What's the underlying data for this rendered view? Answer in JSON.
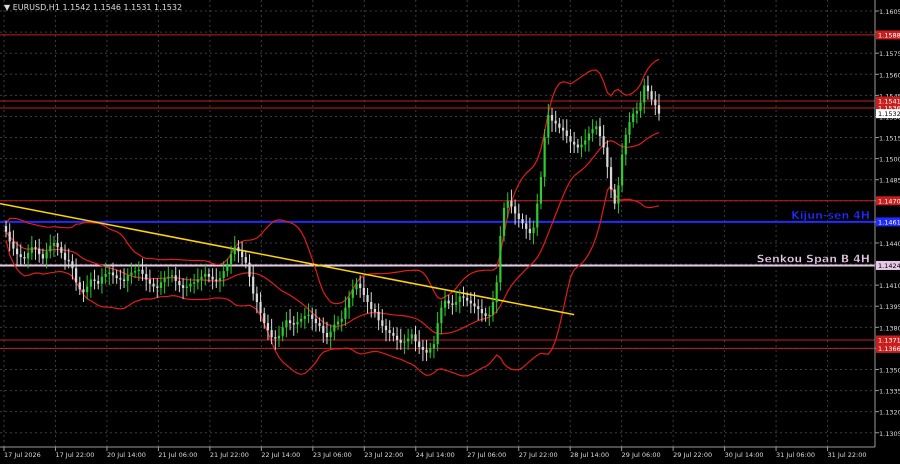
{
  "header": {
    "symbol_label": "▼ EURUSD,H1  1.1542 1.1546 1.1531 1.1532"
  },
  "colors": {
    "background": "#000000",
    "grid": "#3c3c3c",
    "bull_candle": "#2ecc2e",
    "bear_candle": "#d8d8d8",
    "price_axis_text": "#dcdcdc",
    "support_resistance": "#c81e1e",
    "kijun": "#1f2bff",
    "senkou": "#e6c8e6",
    "trendline": "#ffd400",
    "bollinger": "#e01c1c",
    "current_price_tag": "#ffffff"
  },
  "chart_data": {
    "type": "candlestick",
    "title": "EURUSD,H1",
    "ohlc_readout": {
      "open": 1.1542,
      "high": 1.1546,
      "low": 1.1531,
      "close": 1.1532
    },
    "ylim": [
      1.1297,
      1.161
    ],
    "y_ticks": [
      "1.1605",
      "1.1590",
      "1.1575",
      "1.1560",
      "1.1545",
      "1.1530",
      "1.1515",
      "1.1500",
      "1.1485",
      "1.1470",
      "1.1455",
      "1.1440",
      "1.1425",
      "1.1410",
      "1.1395",
      "1.1380",
      "1.1365",
      "1.1350",
      "1.1335",
      "1.1320",
      "1.1305"
    ],
    "x_ticks": [
      "17 Jul 2026",
      "17 Jul 22:00",
      "20 Jul 14:00",
      "21 Jul 06:00",
      "21 Jul 22:00",
      "22 Jul 14:00",
      "23 Jul 06:00",
      "23 Jul 22:00",
      "24 Jul 14:00",
      "27 Jul 06:00",
      "27 Jul 22:00",
      "28 Jul 14:00",
      "29 Jul 06:00",
      "29 Jul 22:00",
      "30 Jul 14:00",
      "31 Jul 06:00",
      "31 Jul 22:00"
    ],
    "horizontal_levels": [
      {
        "price": 1.1588,
        "tag": "1.1588",
        "kind": "resistance"
      },
      {
        "price": 1.1541,
        "tag": "1.1541",
        "kind": "resistance"
      },
      {
        "price": 1.1536,
        "tag": "1.1536",
        "kind": "resistance"
      },
      {
        "price": 1.147,
        "tag": "1.1470",
        "kind": "resistance"
      },
      {
        "price": 1.1455,
        "tag": "1.1461",
        "kind": "kijun",
        "label": "Kijun-sen 4H"
      },
      {
        "price": 1.1424,
        "tag": "1.1424",
        "kind": "senkou",
        "label": "Senkou Span B 4H"
      },
      {
        "price": 1.1371,
        "tag": "1.1371",
        "kind": "support"
      },
      {
        "price": 1.1365,
        "tag": "1.1366",
        "kind": "support"
      }
    ],
    "current_price": {
      "price": 1.1532,
      "tag": "1.1532"
    },
    "trendline": {
      "from": {
        "bar": 0,
        "price": 1.1468
      },
      "to": {
        "bar": 154,
        "price": 1.1389
      }
    },
    "closes": [
      1.1448,
      1.1441,
      1.1436,
      1.1432,
      1.143,
      1.1429,
      1.1433,
      1.1437,
      1.1436,
      1.1432,
      1.1429,
      1.1434,
      1.1438,
      1.144,
      1.1437,
      1.1433,
      1.1428,
      1.1427,
      1.1422,
      1.1412,
      1.1407,
      1.1405,
      1.1409,
      1.1414,
      1.1413,
      1.1411,
      1.1416,
      1.1418,
      1.1419,
      1.1417,
      1.1415,
      1.1414,
      1.1413,
      1.1417,
      1.1419,
      1.142,
      1.1421,
      1.1418,
      1.1414,
      1.1411,
      1.1409,
      1.1408,
      1.1412,
      1.1415,
      1.1416,
      1.1417,
      1.1413,
      1.141,
      1.1408,
      1.1409,
      1.1411,
      1.1412,
      1.1414,
      1.1416,
      1.1418,
      1.1416,
      1.1414,
      1.1413,
      1.1415,
      1.142,
      1.1425,
      1.1432,
      1.1437,
      1.1434,
      1.143,
      1.1426,
      1.1416,
      1.1404,
      1.1398,
      1.139,
      1.1383,
      1.1378,
      1.1373,
      1.1372,
      1.1374,
      1.138,
      1.1385,
      1.1383,
      1.1382,
      1.1384,
      1.1386,
      1.1388,
      1.1389,
      1.1386,
      1.1383,
      1.1381,
      1.1376,
      1.1373,
      1.1377,
      1.1382,
      1.1384,
      1.1386,
      1.1394,
      1.1401,
      1.1407,
      1.1411,
      1.1408,
      1.1403,
      1.1398,
      1.1393,
      1.1391,
      1.1385,
      1.1381,
      1.1378,
      1.1376,
      1.1374,
      1.1371,
      1.1369,
      1.137,
      1.1372,
      1.1375,
      1.137,
      1.1366,
      1.1364,
      1.1362,
      1.1365,
      1.1368,
      1.1383,
      1.1394,
      1.1399,
      1.1397,
      1.1396,
      1.1398,
      1.1402,
      1.1401,
      1.1399,
      1.1397,
      1.1395,
      1.1393,
      1.139,
      1.1388,
      1.1389,
      1.1398,
      1.1412,
      1.1445,
      1.1465,
      1.147,
      1.1466,
      1.1461,
      1.1457,
      1.1454,
      1.145,
      1.1447,
      1.1451,
      1.1468,
      1.1487,
      1.1515,
      1.1531,
      1.1527,
      1.1525,
      1.1522,
      1.152,
      1.1516,
      1.1512,
      1.151,
      1.1508,
      1.151,
      1.1513,
      1.1518,
      1.1521,
      1.1523,
      1.1516,
      1.1508,
      1.1494,
      1.1478,
      1.1468,
      1.1481,
      1.1503,
      1.1517,
      1.1526,
      1.1532,
      1.1534,
      1.154,
      1.1552,
      1.1548,
      1.1542,
      1.1538,
      1.1532
    ]
  }
}
